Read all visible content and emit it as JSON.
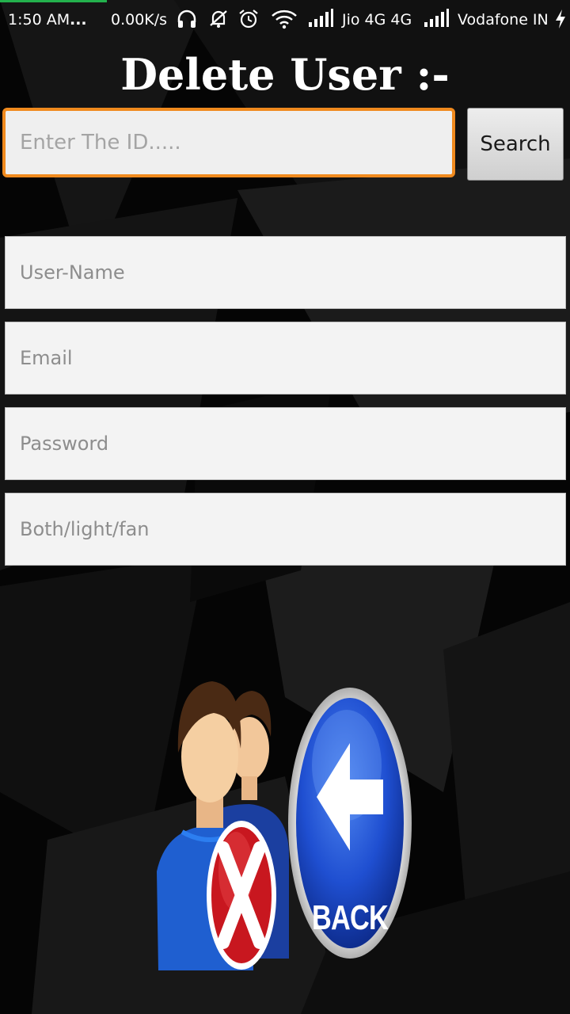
{
  "status_bar": {
    "time": "1:50 AM",
    "overflow": "...",
    "net_speed": "0.00K/s",
    "carrier1": "Jio 4G 4G",
    "carrier2": "Vodafone IN",
    "icons": [
      "headphones-icon",
      "bell-off-icon",
      "alarm-icon",
      "wifi-icon",
      "signal-icon",
      "signal-icon",
      "charging-icon"
    ]
  },
  "page": {
    "title": "Delete User :-"
  },
  "search": {
    "placeholder": "Enter The ID.....",
    "value": "",
    "button_label": "Search"
  },
  "fields": {
    "username_placeholder": "User-Name",
    "email_placeholder": "Email",
    "password_placeholder": "Password",
    "both_placeholder": "Both/light/fan"
  },
  "actions": {
    "back_label": "BACK",
    "delete_icon": "delete-user-icon",
    "back_icon": "back-arrow-icon"
  },
  "colors": {
    "accent": "#f08a1e",
    "background": "#000000",
    "back_blue": "#1f4fd1",
    "delete_red": "#d4232b"
  }
}
